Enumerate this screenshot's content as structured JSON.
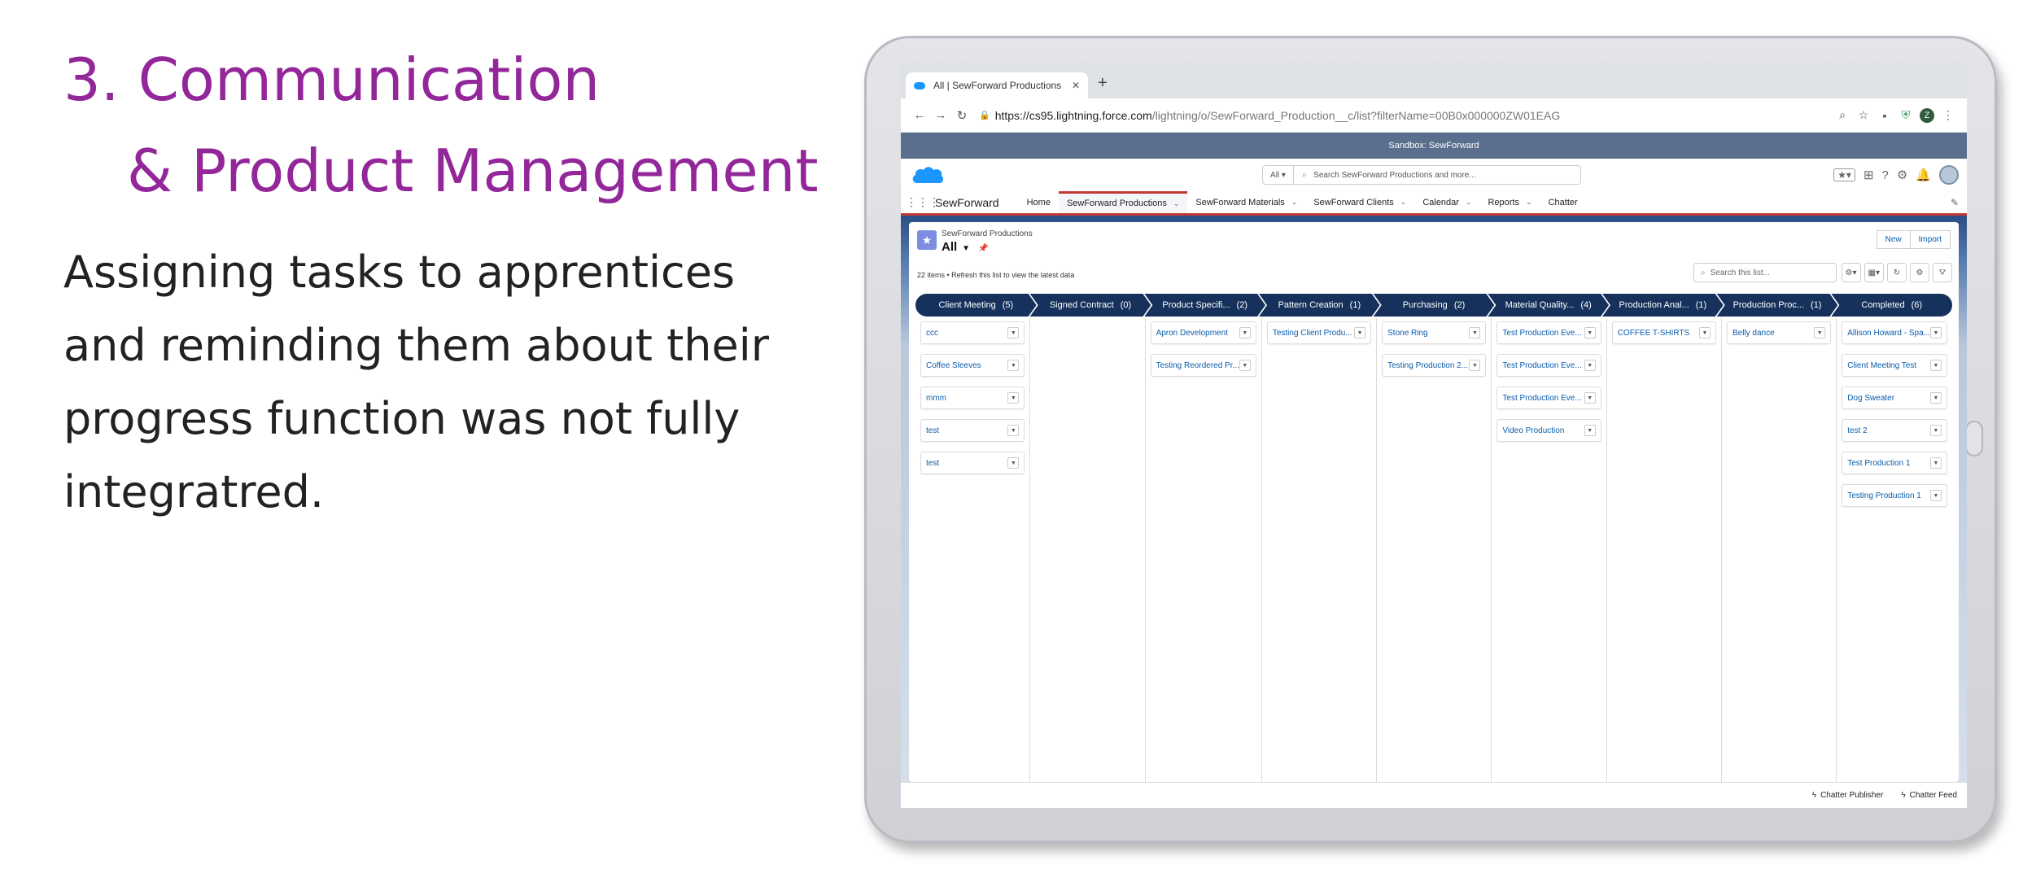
{
  "slide": {
    "title_line1": "3. Communication",
    "title_line2": "& Product Management",
    "body": "Assigning tasks to apprentices and reminding them about their progress function was not fully integratred."
  },
  "browser": {
    "tab_title": "All | SewForward Productions",
    "url_host": "https://cs95.lightning.force.com",
    "url_path": "/lightning/o/SewForward_Production__c/list?filterName=00B0x000000ZW01EAG",
    "profile_letter": "Z"
  },
  "salesforce": {
    "sandbox_banner": "Sandbox: SewForward",
    "search_scope": "All",
    "search_placeholder": "Search SewForward Productions and more...",
    "app_name": "SewForward",
    "nav": [
      {
        "label": "Home"
      },
      {
        "label": "SewForward Productions"
      },
      {
        "label": "SewForward Materials"
      },
      {
        "label": "SewForward Clients"
      },
      {
        "label": "Calendar"
      },
      {
        "label": "Reports"
      },
      {
        "label": "Chatter"
      }
    ],
    "object_name": "SewForward Productions",
    "view_name": "All",
    "new_button": "New",
    "import_button": "Import",
    "count_text": "22 items • Refresh this list to view the latest data",
    "search_list_placeholder": "Search this list...",
    "stages": [
      {
        "label": "Client Meeting",
        "count": "(5)",
        "cards": [
          "ccc",
          "Coffee Sleeves",
          "mmm",
          "test",
          "test"
        ]
      },
      {
        "label": "Signed Contract",
        "count": "(0)",
        "cards": []
      },
      {
        "label": "Product Specifi...",
        "count": "(2)",
        "cards": [
          "Apron Development",
          "Testing Reordered Pr..."
        ]
      },
      {
        "label": "Pattern Creation",
        "count": "(1)",
        "cards": [
          "Testing Client Produ..."
        ]
      },
      {
        "label": "Purchasing",
        "count": "(2)",
        "cards": [
          "Stone Ring",
          "Testing Production 2..."
        ]
      },
      {
        "label": "Material Quality...",
        "count": "(4)",
        "cards": [
          "Test Production Eve...",
          "Test Production Eve...",
          "Test Production Eve...",
          "Video Production"
        ]
      },
      {
        "label": "Production Anal...",
        "count": "(1)",
        "cards": [
          "COFFEE T-SHIRTS"
        ]
      },
      {
        "label": "Production Proc...",
        "count": "(1)",
        "cards": [
          "Belly dance"
        ]
      },
      {
        "label": "Completed",
        "count": "(6)",
        "cards": [
          "Allison Howard - Spa...",
          "Client Meeting Test",
          "Dog Sweater",
          "test 2",
          "Test Production 1",
          "Testing Production 1"
        ]
      }
    ],
    "utility": {
      "publisher": "Chatter Publisher",
      "feed": "Chatter Feed"
    }
  },
  "colors": {
    "title_purple": "#93279a",
    "stage_navy": "#16325c",
    "link_blue": "#0b5cab",
    "nav_red": "#c23934"
  }
}
